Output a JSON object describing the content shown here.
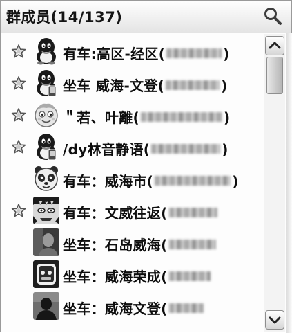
{
  "header": {
    "title": "群成员(14/137)",
    "search_icon": "magnifier-icon"
  },
  "members": [
    {
      "label": "有车:高区-经区(",
      "close": ")",
      "starred": true,
      "avatar": "qq-penguin"
    },
    {
      "label": "坐车 威海-文登(",
      "close": ")",
      "starred": true,
      "avatar": "qq-penguin-mobile"
    },
    {
      "label": "＂若、叶離(",
      "close": ")",
      "starred": true,
      "avatar": "cartoon-face"
    },
    {
      "label": "/dy林音静语(",
      "close": ")",
      "starred": true,
      "avatar": "qq-penguin-mobile"
    },
    {
      "label": "有车：威海市(",
      "close": ")",
      "starred": false,
      "avatar": "panda-face"
    },
    {
      "label": "有车：文威往返(",
      "close": "",
      "starred": true,
      "avatar": "comic-face"
    },
    {
      "label": "坐车：石岛威海(",
      "close": "",
      "starred": false,
      "avatar": "photo-person"
    },
    {
      "label": "坐车：威海荣成(",
      "close": "",
      "starred": false,
      "avatar": "app-icon"
    },
    {
      "label": "坐车：威海文登(",
      "close": "",
      "starred": false,
      "avatar": "photo-silhouette"
    }
  ],
  "colors": {
    "header_bg": "#e4e4e4",
    "text": "#0e0e0e",
    "star_stroke": "#555555"
  }
}
